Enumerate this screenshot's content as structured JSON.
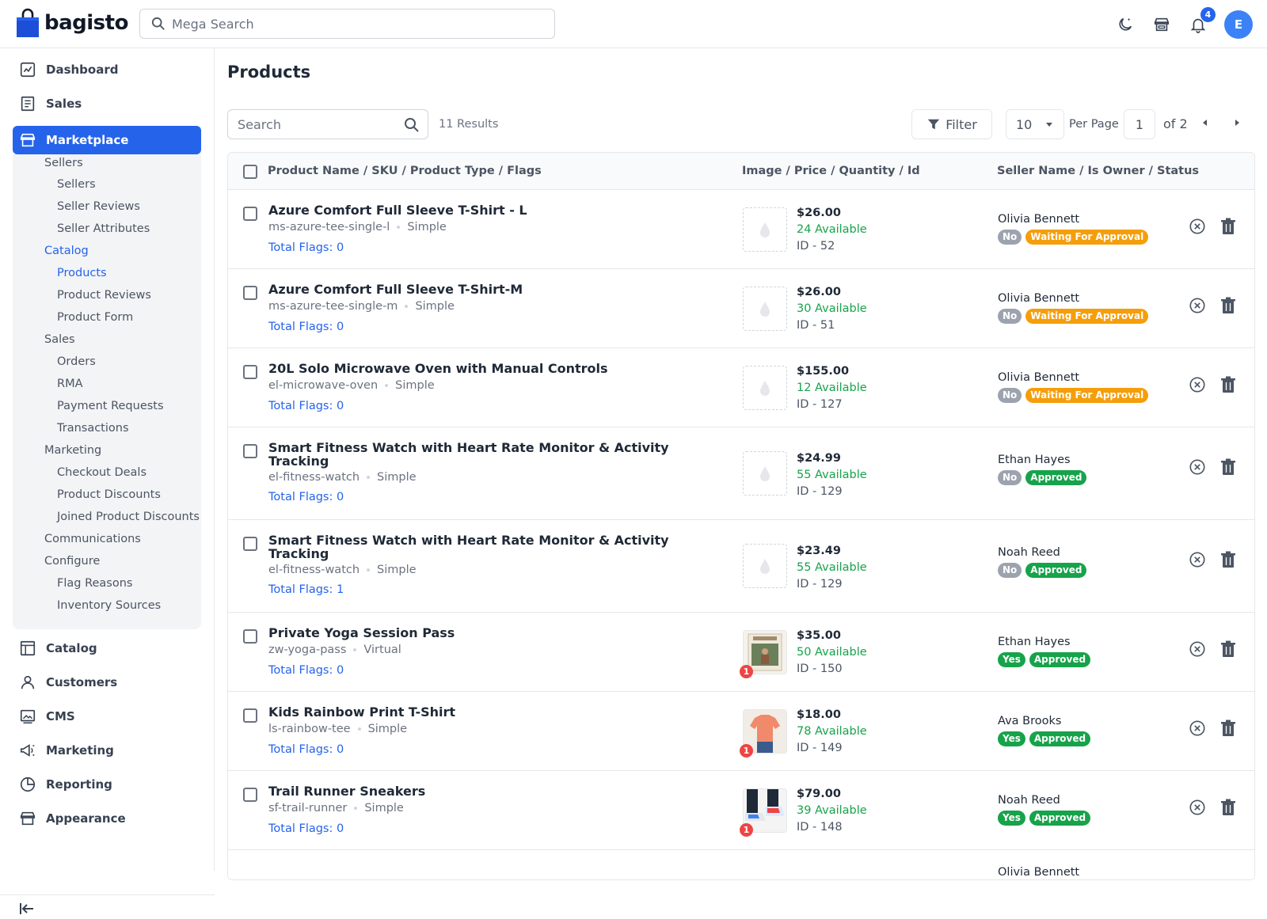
{
  "app": {
    "logo_text": "bagisto",
    "search_placeholder": "Mega Search",
    "notification_count": "4",
    "avatar_initial": "E"
  },
  "sidebar": {
    "main_items": [
      {
        "label": "Dashboard",
        "icon": "dashboard-icon"
      },
      {
        "label": "Sales",
        "icon": "receipt-icon"
      },
      {
        "label": "Marketplace",
        "icon": "store-icon",
        "active": true
      }
    ],
    "marketplace_sub": [
      {
        "label": "Sellers",
        "level": 1
      },
      {
        "label": "Sellers",
        "level": 2
      },
      {
        "label": "Seller Reviews",
        "level": 2
      },
      {
        "label": "Seller Attributes",
        "level": 2
      },
      {
        "label": "Catalog",
        "level": 1,
        "highlight": true
      },
      {
        "label": "Products",
        "level": 2,
        "highlight": true
      },
      {
        "label": "Product Reviews",
        "level": 2
      },
      {
        "label": "Product Form",
        "level": 2
      },
      {
        "label": "Sales",
        "level": 1
      },
      {
        "label": "Orders",
        "level": 2
      },
      {
        "label": "RMA",
        "level": 2
      },
      {
        "label": "Payment Requests",
        "level": 2
      },
      {
        "label": "Transactions",
        "level": 2
      },
      {
        "label": "Marketing",
        "level": 1
      },
      {
        "label": "Checkout Deals",
        "level": 2
      },
      {
        "label": "Product Discounts",
        "level": 2
      },
      {
        "label": "Joined Product Discounts",
        "level": 2
      },
      {
        "label": "Communications",
        "level": 1
      },
      {
        "label": "Configure",
        "level": 1
      },
      {
        "label": "Flag Reasons",
        "level": 2
      },
      {
        "label": "Inventory Sources",
        "level": 2
      }
    ],
    "bottom_items": [
      {
        "label": "Catalog",
        "icon": "catalog-icon"
      },
      {
        "label": "Customers",
        "icon": "user-icon"
      },
      {
        "label": "CMS",
        "icon": "image-icon"
      },
      {
        "label": "Marketing",
        "icon": "megaphone-icon"
      },
      {
        "label": "Reporting",
        "icon": "pie-chart-icon"
      },
      {
        "label": "Appearance",
        "icon": "store-front-icon"
      }
    ]
  },
  "page": {
    "title": "Products",
    "search_placeholder": "Search",
    "results": "11 Results",
    "filter_label": "Filter",
    "per_page_value": "10",
    "per_page_label": "Per Page",
    "page_current": "1",
    "page_of": "of 2"
  },
  "table": {
    "headers": [
      "Product Name / SKU / Product Type / Flags",
      "Image / Price / Quantity / Id",
      "Seller Name / Is Owner / Status"
    ],
    "rows": [
      {
        "name": "Azure Comfort Full Sleeve T-Shirt - L",
        "sku": "ms-azure-tee-single-l",
        "type": "Simple",
        "flags": "Total Flags: 0",
        "price": "$26.00",
        "qty": "24 Available",
        "id": "ID - 52",
        "seller": "Olivia Bennett",
        "owner": "No",
        "status": "Waiting For Approval",
        "image": "placeholder"
      },
      {
        "name": "Azure Comfort Full Sleeve T-Shirt-M",
        "sku": "ms-azure-tee-single-m",
        "type": "Simple",
        "flags": "Total Flags: 0",
        "price": "$26.00",
        "qty": "30 Available",
        "id": "ID - 51",
        "seller": "Olivia Bennett",
        "owner": "No",
        "status": "Waiting For Approval",
        "image": "placeholder"
      },
      {
        "name": "20L Solo Microwave Oven with Manual Controls",
        "sku": "el-microwave-oven",
        "type": "Simple",
        "flags": "Total Flags: 0",
        "price": "$155.00",
        "qty": "12 Available",
        "id": "ID - 127",
        "seller": "Olivia Bennett",
        "owner": "No",
        "status": "Waiting For Approval",
        "image": "placeholder"
      },
      {
        "name": "Smart Fitness Watch with Heart Rate Monitor & Activity Tracking",
        "sku": "el-fitness-watch",
        "type": "Simple",
        "flags": "Total Flags: 0",
        "price": "$24.99",
        "qty": "55 Available",
        "id": "ID - 129",
        "seller": "Ethan Hayes",
        "owner": "No",
        "status": "Approved",
        "image": "placeholder"
      },
      {
        "name": "Smart Fitness Watch with Heart Rate Monitor & Activity Tracking",
        "sku": "el-fitness-watch",
        "type": "Simple",
        "flags": "Total Flags: 1",
        "price": "$23.49",
        "qty": "55 Available",
        "id": "ID - 129",
        "seller": "Noah Reed",
        "owner": "No",
        "status": "Approved",
        "image": "placeholder"
      },
      {
        "name": "Private Yoga Session Pass",
        "sku": "zw-yoga-pass",
        "type": "Virtual",
        "flags": "Total Flags: 0",
        "price": "$35.00",
        "qty": "50 Available",
        "id": "ID - 150",
        "seller": "Ethan Hayes",
        "owner": "Yes",
        "status": "Approved",
        "image": "yoga",
        "image_count": "1"
      },
      {
        "name": "Kids Rainbow Print T-Shirt",
        "sku": "ls-rainbow-tee",
        "type": "Simple",
        "flags": "Total Flags: 0",
        "price": "$18.00",
        "qty": "78 Available",
        "id": "ID - 149",
        "seller": "Ava Brooks",
        "owner": "Yes",
        "status": "Approved",
        "image": "tshirt",
        "image_count": "1"
      },
      {
        "name": "Trail Runner Sneakers",
        "sku": "sf-trail-runner",
        "type": "Simple",
        "flags": "Total Flags: 0",
        "price": "$79.00",
        "qty": "39 Available",
        "id": "ID - 148",
        "seller": "Noah Reed",
        "owner": "Yes",
        "status": "Approved",
        "image": "sneakers",
        "image_count": "1"
      },
      {
        "name": "",
        "sku": "",
        "type": "",
        "flags": "",
        "price": "",
        "qty": "",
        "id": "",
        "seller": "Olivia Bennett",
        "owner": "",
        "status": "",
        "image": "none"
      }
    ]
  },
  "colors": {
    "accent": "#2563eb",
    "approved": "#16a34a",
    "waiting": "#f59e0b",
    "no_badge": "#9ca3af",
    "danger": "#ef4444"
  }
}
